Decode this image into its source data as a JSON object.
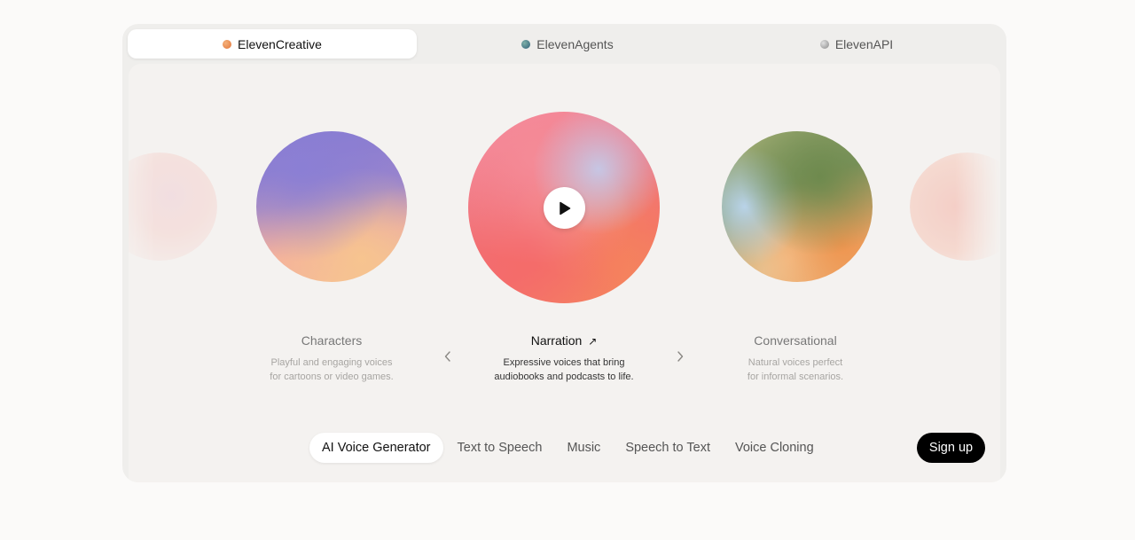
{
  "product_tabs": [
    {
      "label": "ElevenCreative",
      "icon": "orange-orb-icon",
      "color": "#e88a4a",
      "active": true
    },
    {
      "label": "ElevenAgents",
      "icon": "teal-orb-icon",
      "color": "#3f7b86",
      "active": false
    },
    {
      "label": "ElevenAPI",
      "icon": "gray-orb-icon",
      "color": "#9a9a9a",
      "active": false
    }
  ],
  "carousel": {
    "items": [
      {
        "title": "Characters",
        "description": "Playful and engaging voices\nfor cartoons or video games."
      },
      {
        "title": "Narration",
        "description": "Expressive voices that bring\naudiobooks and podcasts to life.",
        "active": true
      },
      {
        "title": "Conversational",
        "description": "Natural voices perfect\nfor informal scenarios."
      }
    ],
    "active_title_arrow": "↗",
    "prev_icon": "chevron-left-icon",
    "next_icon": "chevron-right-icon",
    "play_icon": "play-icon"
  },
  "bottom_nav": {
    "items": [
      "AI Voice Generator",
      "Text to Speech",
      "Music",
      "Speech to Text",
      "Voice Cloning"
    ],
    "active": "AI Voice Generator",
    "signup_label": "Sign up"
  }
}
